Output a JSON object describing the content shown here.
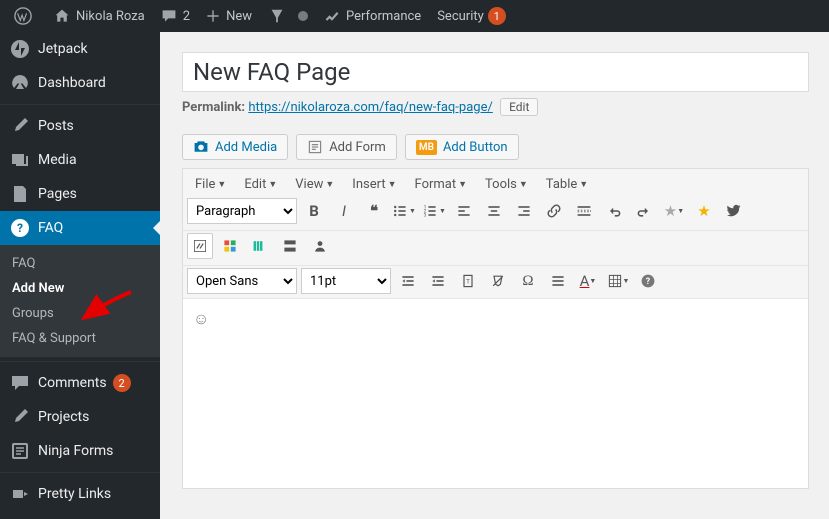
{
  "topbar": {
    "site_name": "Nikola Roza",
    "comment_count": "2",
    "new_label": "New",
    "performance_label": "Performance",
    "security_label": "Security",
    "security_count": "1"
  },
  "sidebar": {
    "jetpack": "Jetpack",
    "dashboard": "Dashboard",
    "posts": "Posts",
    "media": "Media",
    "pages": "Pages",
    "faq": "FAQ",
    "submenu": {
      "faq": "FAQ",
      "add_new": "Add New",
      "groups": "Groups",
      "faq_support": "FAQ & Support"
    },
    "comments": "Comments",
    "comments_count": "2",
    "projects": "Projects",
    "ninja_forms": "Ninja Forms",
    "pretty_links": "Pretty Links"
  },
  "page": {
    "title": "New FAQ Page",
    "permalink_label": "Permalink:",
    "permalink_base": "https://nikolaroza.com/faq/",
    "permalink_slug": "new-faq-page/",
    "edit_btn": "Edit"
  },
  "media": {
    "add_media": "Add Media",
    "add_form": "Add Form",
    "mb_badge": "MB",
    "add_button": "Add Button"
  },
  "editor": {
    "menus": [
      "File",
      "Edit",
      "View",
      "Insert",
      "Format",
      "Tools",
      "Table"
    ],
    "format_select": "Paragraph",
    "font_select": "Open Sans",
    "size_select": "11pt"
  },
  "chart_data": null
}
